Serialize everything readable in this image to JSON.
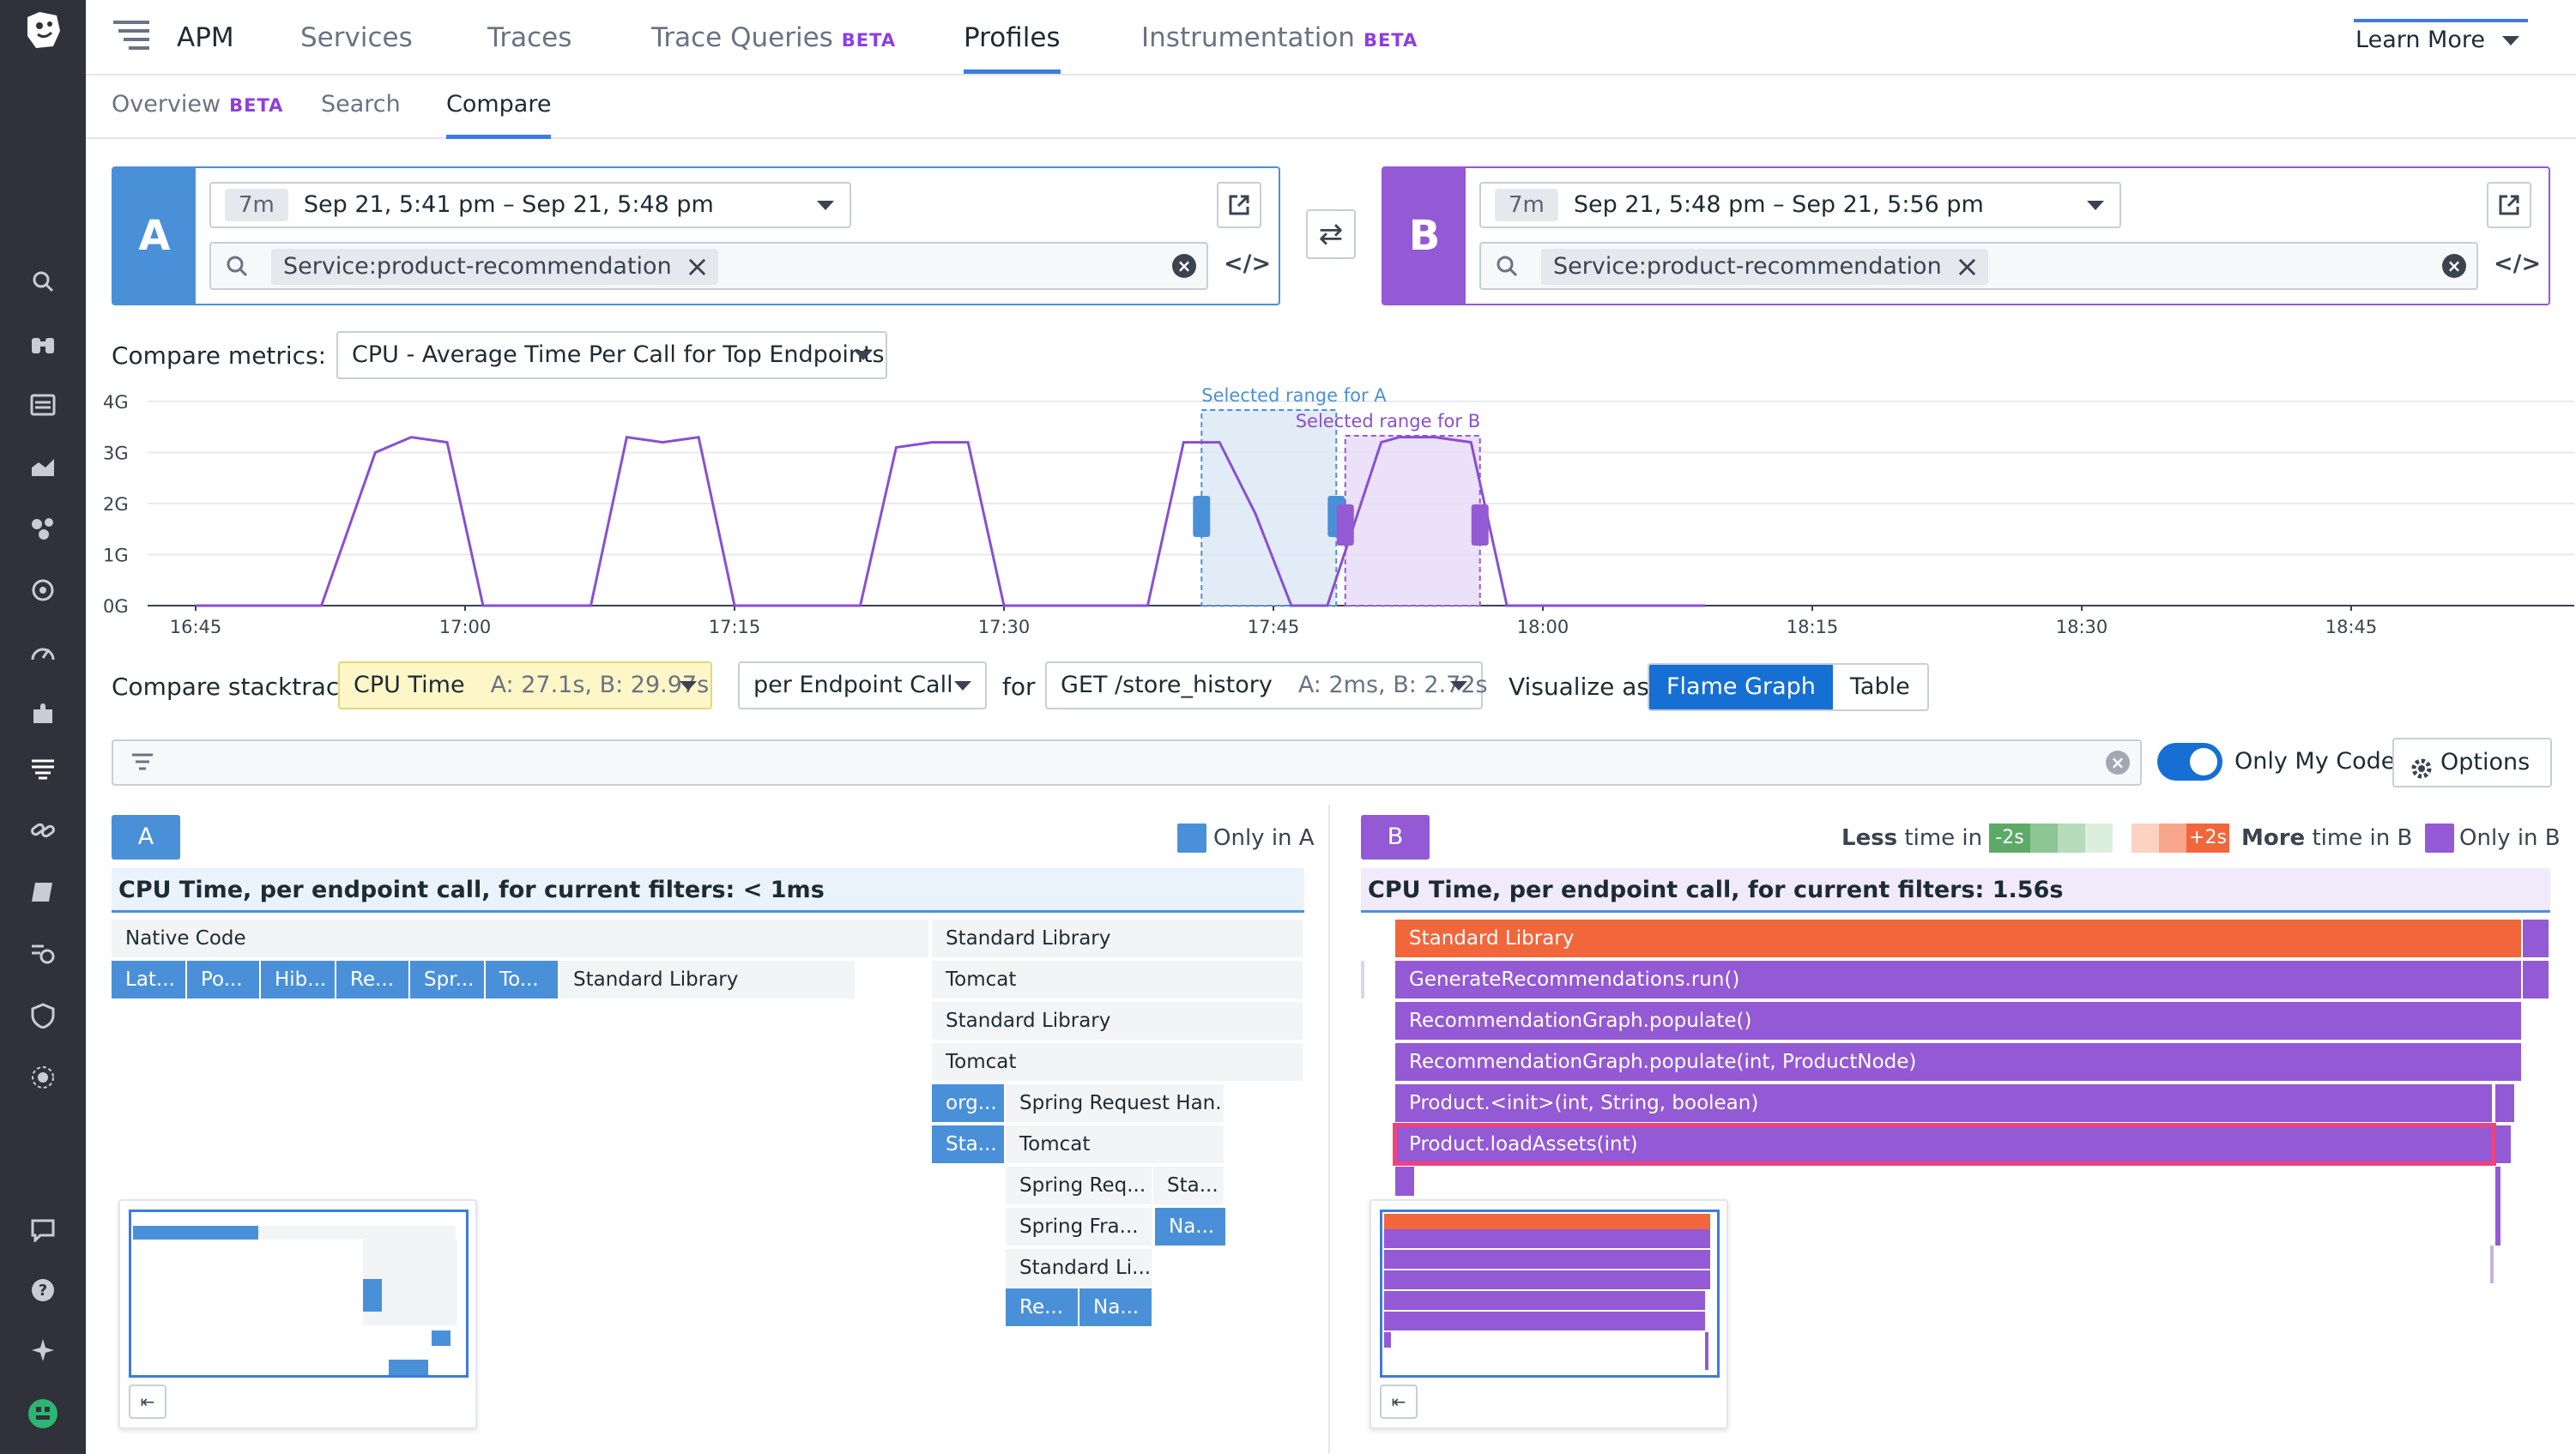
{
  "nav": {
    "app": "APM",
    "items": [
      "Services",
      "Traces",
      "Trace Queries",
      "Profiles",
      "Instrumentation"
    ],
    "beta": "BETA",
    "learn_more": "Learn More"
  },
  "subnav": {
    "overview": "Overview",
    "beta": "BETA",
    "search": "Search",
    "compare": "Compare"
  },
  "queryA": {
    "tag": "A",
    "duration": "7m",
    "range": "Sep 21, 5:41 pm – Sep 21, 5:48 pm",
    "chip": "Service:product-recommendation",
    "color": "#4a90d9"
  },
  "queryB": {
    "tag": "B",
    "duration": "7m",
    "range": "Sep 21, 5:48 pm – Sep 21, 5:56 pm",
    "chip": "Service:product-recommendation",
    "color": "#9459d4"
  },
  "metrics": {
    "label": "Compare metrics:",
    "value": "CPU - Average Time Per Call for Top Endpoints"
  },
  "chart_data": {
    "type": "line",
    "y_ticks": [
      "4G",
      "3G",
      "2G",
      "1G",
      "0G"
    ],
    "x_ticks": [
      "16:45",
      "17:00",
      "17:15",
      "17:30",
      "17:45",
      "18:00",
      "18:15",
      "18:30",
      "18:45"
    ],
    "ylim": [
      0,
      4
    ],
    "x_minutes": [
      0,
      7,
      10,
      12,
      14,
      16,
      21,
      22,
      24,
      26,
      28,
      30,
      36,
      37,
      39,
      41,
      43,
      45,
      51,
      53,
      55,
      57,
      59,
      61,
      63,
      66,
      67,
      69,
      71,
      73,
      75,
      79,
      81,
      84
    ],
    "y_values": [
      0,
      0,
      3.0,
      3.3,
      3.2,
      0,
      0,
      0,
      3.3,
      3.2,
      3.3,
      0,
      0,
      0,
      3.1,
      3.2,
      3.2,
      0,
      0,
      0,
      3.2,
      3.2,
      1.8,
      0,
      0,
      3.2,
      3.3,
      3.3,
      3.2,
      0,
      0,
      0,
      0,
      0
    ],
    "x_start_label": "16:45",
    "selection_a": {
      "label": "Selected range for A",
      "from_min": 56,
      "to_min": 63.5
    },
    "selection_b": {
      "label": "Selected range for B",
      "from_min": 64,
      "to_min": 71.5
    }
  },
  "stacktrace": {
    "label": "Compare stacktrace:",
    "type": "CPU Time",
    "type_sub": "A: 27.1s, B: 29.97s",
    "per": "per Endpoint Call",
    "for": "for",
    "endpoint": "GET /store_history",
    "endpoint_sub": "A: 2ms, B: 2.72s",
    "visualize": "Visualize as:",
    "flame": "Flame Graph",
    "table": "Table"
  },
  "filter": {
    "only_my_code": "Only My Code",
    "options": "Options"
  },
  "flameA": {
    "tag": "A",
    "legend": "Only in A",
    "header": "CPU Time, per endpoint call, for current filters: < 1ms",
    "frames": {
      "native": "Native Code",
      "lat": "Lat...",
      "po": "Po...",
      "hib": "Hib...",
      "re1": "Re...",
      "spr": "Spr...",
      "to": "To...",
      "stdlib_left": "Standard Library",
      "stdlib1": "Standard Library",
      "tomcat1": "Tomcat",
      "stdlib2": "Standard Library",
      "tomcat2": "Tomcat",
      "org": "org...",
      "spring_req_han": "Spring Request Han...",
      "sta1": "Sta...",
      "tomcat3": "Tomcat",
      "spring_req": "Spring Req...",
      "sta2": "Sta...",
      "spring_fra": "Spring Fra...",
      "na1": "Na...",
      "stdli": "Standard Li...",
      "re2": "Re...",
      "na2": "Na..."
    }
  },
  "flameB": {
    "tag": "B",
    "less": "Less",
    "less_tail": "time in B",
    "minus": "-2s",
    "plus": "+2s",
    "more": "More",
    "more_tail": "time in B",
    "legend": "Only in B",
    "header": "CPU Time, per endpoint call, for current filters: 1.56s",
    "frames": {
      "f1": "Standard Library",
      "f2": "GenerateRecommendations.run()",
      "f3": "RecommendationGraph.populate()",
      "f4": "RecommendationGraph.populate(int, ProductNode)",
      "f5": "Product.<init>(int, String, boolean)",
      "f6": "Product.loadAssets(int)"
    }
  }
}
